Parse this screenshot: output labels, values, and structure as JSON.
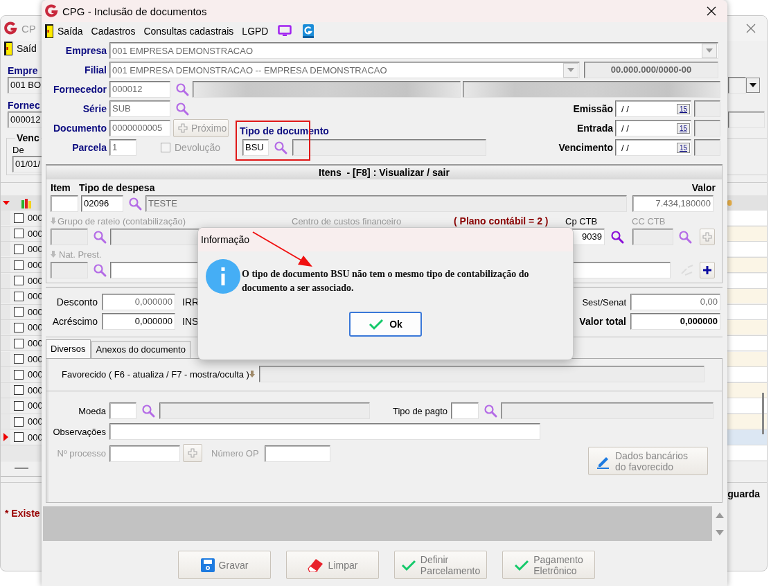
{
  "background_window": {
    "title": "CP",
    "menu_item": "Saíd",
    "empresa_label": "Empre",
    "empresa_value": "001 BO",
    "fornecedor_label": "Fornec",
    "fornecedor_value": "000012",
    "group_label": "Venc",
    "de_label": "De",
    "de_value": "01/01/",
    "rows": [
      {
        "code": "000",
        "checked": false,
        "current": false
      },
      {
        "code": "000",
        "checked": false,
        "current": false
      },
      {
        "code": "000",
        "checked": false,
        "current": false
      },
      {
        "code": "000",
        "checked": false,
        "current": false
      },
      {
        "code": "000",
        "checked": false,
        "current": false
      },
      {
        "code": "000",
        "checked": false,
        "current": false
      },
      {
        "code": "000",
        "checked": false,
        "current": false
      },
      {
        "code": "000",
        "checked": false,
        "current": false
      },
      {
        "code": "000",
        "checked": false,
        "current": false
      },
      {
        "code": "000",
        "checked": false,
        "current": false
      },
      {
        "code": "000",
        "checked": false,
        "current": false
      },
      {
        "code": "000",
        "checked": false,
        "current": false
      },
      {
        "code": "000",
        "checked": false,
        "current": false
      },
      {
        "code": "000",
        "checked": false,
        "current": false
      },
      {
        "code": "000",
        "checked": false,
        "current": true
      }
    ],
    "right_label": "guarda",
    "footer_note": "* Existe"
  },
  "window": {
    "title": "CPG - Inclusão de documentos"
  },
  "menu": [
    {
      "kind": "exit",
      "label": "Saída"
    },
    {
      "kind": "text",
      "label": "Cadastros"
    },
    {
      "kind": "text",
      "label": "Consultas cadastrais"
    },
    {
      "kind": "text",
      "label": "LGPD"
    },
    {
      "kind": "monitor"
    },
    {
      "kind": "logo"
    }
  ],
  "header": {
    "empresa": {
      "label": "Empresa",
      "value": "001 EMPRESA DEMONSTRACAO"
    },
    "filial": {
      "label": "Filial",
      "value": "001 EMPRESA DEMONSTRACAO -- EMPRESA DEMONSTRACAO",
      "cnpj": "00.000.000/0000-00"
    },
    "fornecedor": {
      "label": "Fornecedor",
      "value": "000012"
    },
    "serie": {
      "label": "Série",
      "value": "SUB"
    },
    "documento": {
      "label": "Documento",
      "value": "0000000005",
      "next_button": {
        "label": "Próximo",
        "disabled": true
      }
    },
    "parcela": {
      "label": "Parcela",
      "value": "1",
      "devolucao": {
        "label": "Devolução",
        "checked": false,
        "disabled": true
      }
    },
    "tipo_documento": {
      "label": "Tipo de documento",
      "value": "BSU",
      "highlighted": true
    },
    "dates": [
      {
        "label": "Emissão",
        "value": "/ /",
        "calendar": "15"
      },
      {
        "label": "Entrada",
        "value": "/ /",
        "calendar": "15"
      },
      {
        "label": "Vencimento",
        "value": "/ /",
        "calendar": "15"
      }
    ]
  },
  "items": {
    "title": "Itens  - [F8] : Visualizar / sair",
    "item_label": "Item",
    "despesa_label": "Tipo de despesa",
    "despesa_code": "02096",
    "despesa_name": "TESTE",
    "valor_label": "Valor",
    "valor": "7.434,180000",
    "grupo_rateio": {
      "label": "Grupo de rateio (contabilização)",
      "disabled": true
    },
    "centro_custos": {
      "label": "Centro de custos financeiro",
      "disabled": true
    },
    "plano_contabil": "( Plano contábil = 2 )",
    "cp_ctb": {
      "label": "Cp CTB",
      "value": "9039",
      "disabled": false
    },
    "cc_ctb": {
      "label": "CC CTB",
      "disabled": true
    },
    "nat_prest": {
      "label": "Nat. Prest.",
      "disabled": true
    }
  },
  "totals": {
    "left": [
      {
        "label": "Desconto",
        "value": "0,000000",
        "disabled": true,
        "tax_label": "IRR"
      },
      {
        "label": "Acréscimo",
        "value": "0,000000",
        "disabled": false,
        "tax_label": "INS"
      }
    ],
    "sest_senat": {
      "label": "Sest/Senat",
      "value": "0,00"
    },
    "valor_total": {
      "label": "Valor total",
      "value": "0,000000"
    }
  },
  "tabs": [
    {
      "label": "Diversos",
      "selected": true
    },
    {
      "label": "Anexos do documento",
      "selected": false
    }
  ],
  "diversos": {
    "favorecido_label": "Favorecido ( F6 - atualiza / F7 - mostra/oculta )",
    "moeda_label": "Moeda",
    "tipo_pagto_label": "Tipo de pagto",
    "observacoes_label": "Observações",
    "processo": {
      "label": "Nº processo",
      "disabled": true
    },
    "numero_op": {
      "label": "Número OP",
      "disabled": true
    },
    "bank_button": "Dados bancários\ndo favorecido"
  },
  "buttons": [
    {
      "kind": "save",
      "label": "Gravar"
    },
    {
      "kind": "clear",
      "label": "Limpar"
    },
    {
      "kind": "check",
      "label": "Definir\nParcelamento"
    },
    {
      "kind": "check",
      "label": "Pagamento\nEletrônico"
    }
  ],
  "dialog": {
    "title": "Informação",
    "message": "O tipo de documento BSU não tem o mesmo tipo de contabilização do documento a ser associado.",
    "button": "Ok"
  }
}
